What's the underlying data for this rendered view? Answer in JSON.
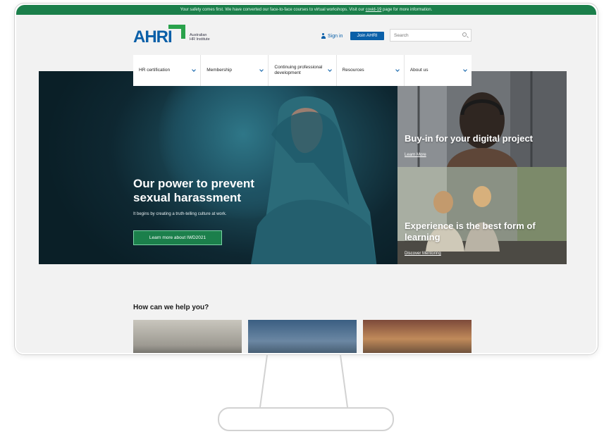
{
  "banner": {
    "text_before": "Your safety comes first. We have converted our face-to-face courses to virtual workshops. Visit our ",
    "link": "covid-19",
    "text_after": " page for more information."
  },
  "header": {
    "logo_text": "AHRI",
    "logo_sub_line1": "Australian",
    "logo_sub_line2": "HR Institute",
    "signin_label": "Sign in",
    "join_label": "Join AHRI",
    "search_placeholder": "Search"
  },
  "nav": {
    "items": [
      {
        "label": "HR certification"
      },
      {
        "label": "Membership"
      },
      {
        "label": "Continuing professional development"
      },
      {
        "label": "Resources"
      },
      {
        "label": "About us"
      }
    ]
  },
  "hero": {
    "title_line1": "Our power to prevent",
    "title_line2": "sexual harassment",
    "subtitle": "It begins by creating a truth-telling culture at work.",
    "button_label": "Learn more about IWD2021"
  },
  "cards": [
    {
      "title": "Buy-in for your digital project",
      "link": "Learn More"
    },
    {
      "title_line1": "Experience is the best form of",
      "title_line2": "learning",
      "link": "Discover Mentoring"
    }
  ],
  "help": {
    "title": "How can we help you?"
  },
  "colors": {
    "brand_blue": "#0a5fa8",
    "brand_green": "#1b7f4b",
    "logo_green": "#2aa24b"
  }
}
